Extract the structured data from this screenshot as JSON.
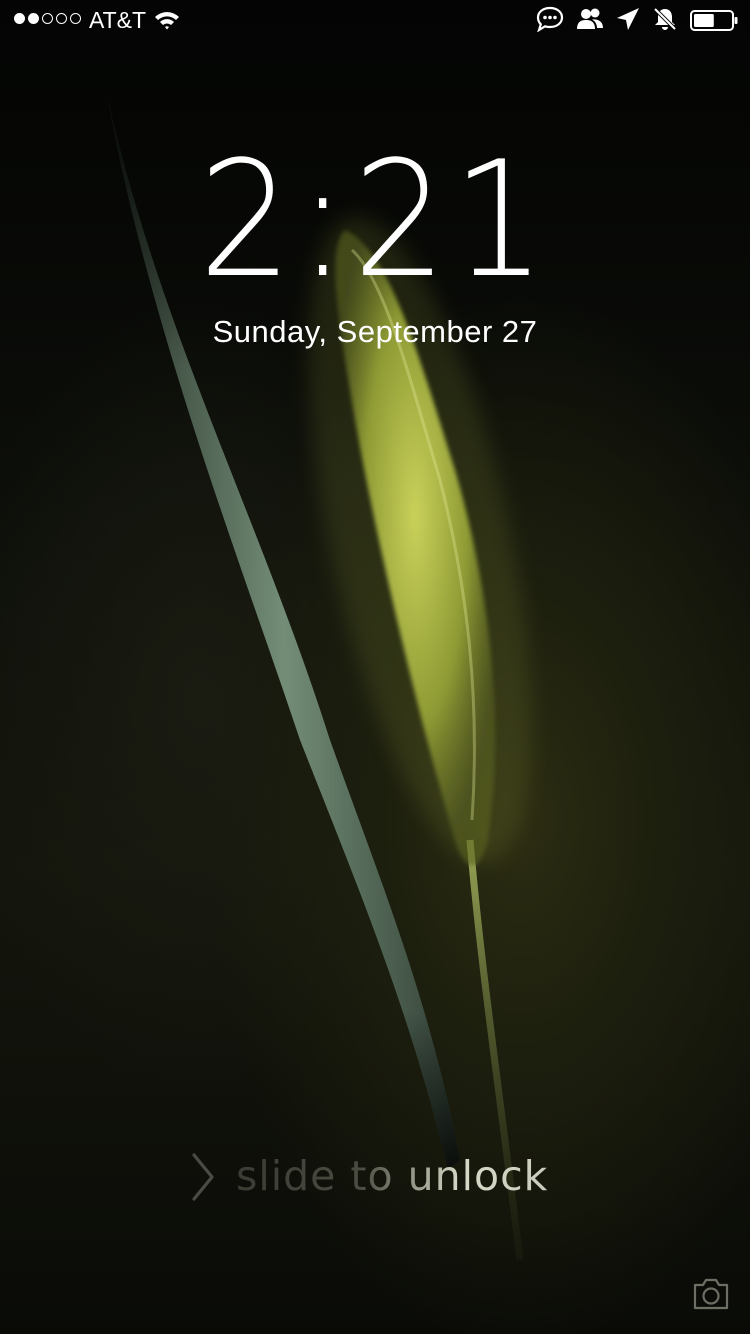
{
  "status_bar": {
    "signal_bars_filled": 2,
    "signal_bars_total": 5,
    "carrier": "AT&T",
    "icons": [
      "wifi-icon",
      "message-icon",
      "contacts-icon",
      "location-arrow-icon",
      "mute-bell-icon",
      "battery-icon"
    ],
    "battery_level": 0.55
  },
  "lock_screen": {
    "time": "2:21",
    "date": "Sunday, September 27",
    "unlock_prompt": "slide to unlock",
    "camera_shortcut": "camera-icon"
  },
  "colors": {
    "text": "#ffffff",
    "wallpaper_dark": "#050604",
    "grass_green": "#b5c24a",
    "blade_green": "#6b8a6b"
  }
}
